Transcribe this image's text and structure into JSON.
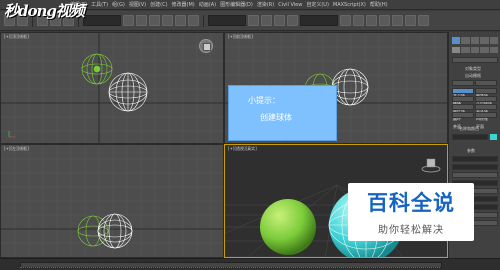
{
  "watermark_logo": "秒dong视频",
  "menu": [
    "编辑(E)",
    "工具(T)",
    "组(G)",
    "视图(V)",
    "创建(C)",
    "修改器(M)",
    "动画(A)",
    "图形编辑器(D)",
    "渲染(R)",
    "Civil View",
    "自定义(U)",
    "MAXScript(X)",
    "帮助(H)"
  ],
  "viewports": {
    "top_label": "[+][顶][线框]",
    "front_label": "[+][前][线框]",
    "left_label": "[+][左][线框]",
    "persp_label": "[+][透视][真实]"
  },
  "tip": {
    "title": "小提示：",
    "body": "创建球体"
  },
  "command_panel": {
    "rollout_title": "对象类型",
    "autogrid": "自动栅格",
    "objects": [
      "长方体",
      "圆锥体",
      "球体",
      "几何球体",
      "圆柱体",
      "管状体",
      "圆环",
      "四棱锥",
      "茶壶",
      "平面"
    ],
    "name_color": "名称和颜色",
    "params": "参数"
  },
  "brand_watermark": {
    "title": "百科全说",
    "subtitle": "助你轻松解决"
  },
  "colors": {
    "tip_bg": "#7fc1ff",
    "green_sphere": "#7ccc3a",
    "cyan_sphere": "#3fd3d6",
    "persp_border": "#c7a000"
  }
}
